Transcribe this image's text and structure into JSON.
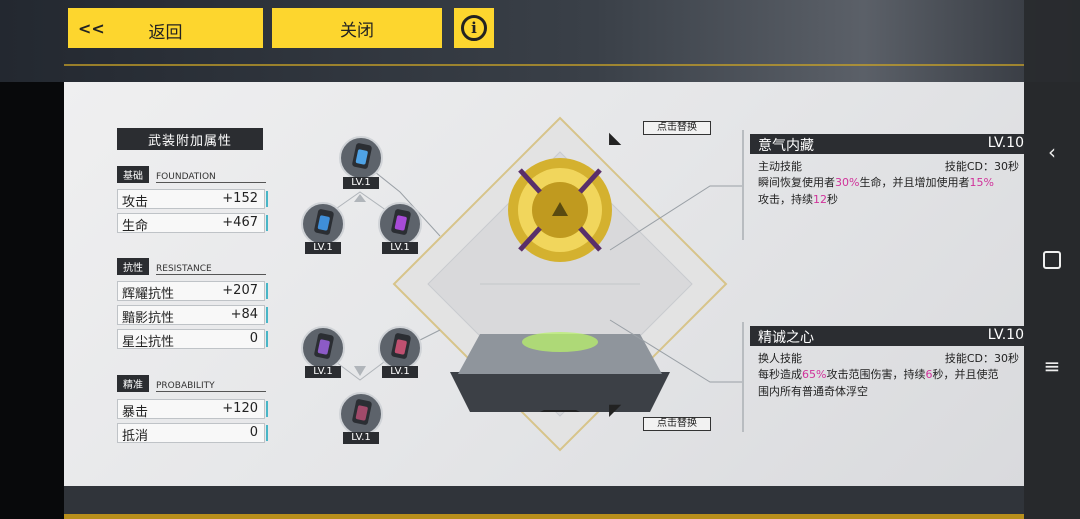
{
  "toolbar": {
    "back_arrow": "<<",
    "back_label": "返回",
    "close_label": "关闭",
    "info_icon": "i"
  },
  "stats": {
    "title": "武装附加属性",
    "groups": [
      {
        "tag": "基础",
        "en": "FOUNDATION",
        "rows": [
          {
            "k": "攻击",
            "v": "+152"
          },
          {
            "k": "生命",
            "v": "+467"
          }
        ]
      },
      {
        "tag": "抗性",
        "en": "RESISTANCE",
        "rows": [
          {
            "k": "辉耀抗性",
            "v": "+207"
          },
          {
            "k": "黯影抗性",
            "v": "+84"
          },
          {
            "k": "星尘抗性",
            "v": "0"
          }
        ]
      },
      {
        "tag": "精准",
        "en": "PROBABILITY",
        "rows": [
          {
            "k": "暴击",
            "v": "+120"
          },
          {
            "k": "抵消",
            "v": "0"
          }
        ]
      }
    ]
  },
  "chips": {
    "c1": "LV.1",
    "c2": "LV.1",
    "c3": "LV.1",
    "c4": "LV.1",
    "c5": "LV.1",
    "c6": "LV.1"
  },
  "hints": {
    "top": "点击替换",
    "bottom": "点击替换"
  },
  "skills": [
    {
      "name": "意气内藏",
      "level": "LV.10",
      "type": "主动技能",
      "cd": "技能CD：30秒",
      "d1a": "瞬间恢复使用者",
      "d1b": "30%",
      "d1c": "生命，并且增加使用者",
      "d1d": "15%",
      "d2a": "攻击，持续",
      "d2b": "12",
      "d2c": "秒"
    },
    {
      "name": "精诚之心",
      "level": "LV.10",
      "type": "换人技能",
      "cd": "技能CD：30秒",
      "d1a": "每秒造成",
      "d1b": "65%",
      "d1c": "攻击范围伤害，持续",
      "d1d": "6",
      "d1e": "秒，并且使范",
      "d2a": "围内所有普通奇体浮空"
    }
  ],
  "colors": {
    "accent": "#fdd62e",
    "highlight": "#d0329a",
    "gold": "#c9a227"
  }
}
